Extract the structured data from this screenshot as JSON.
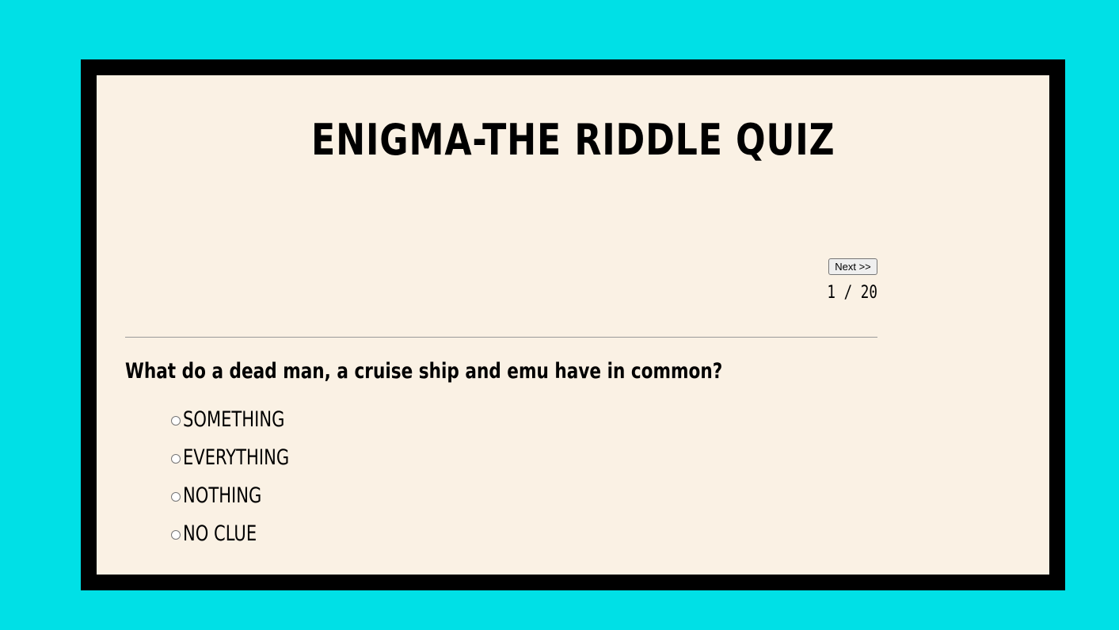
{
  "quiz": {
    "title": "ENIGMA-THE RIDDLE QUIZ",
    "next_label": "Next >>",
    "progress": "1 / 20",
    "question": "What do a dead man, a cruise ship and emu have in common?",
    "options": [
      {
        "label": "SOMETHING"
      },
      {
        "label": "EVERYTHING"
      },
      {
        "label": "NOTHING"
      },
      {
        "label": "NO CLUE"
      }
    ]
  },
  "colors": {
    "page_background": "#00e0e6",
    "frame": "#000000",
    "panel": "#faf1e4",
    "text": "#000000"
  }
}
